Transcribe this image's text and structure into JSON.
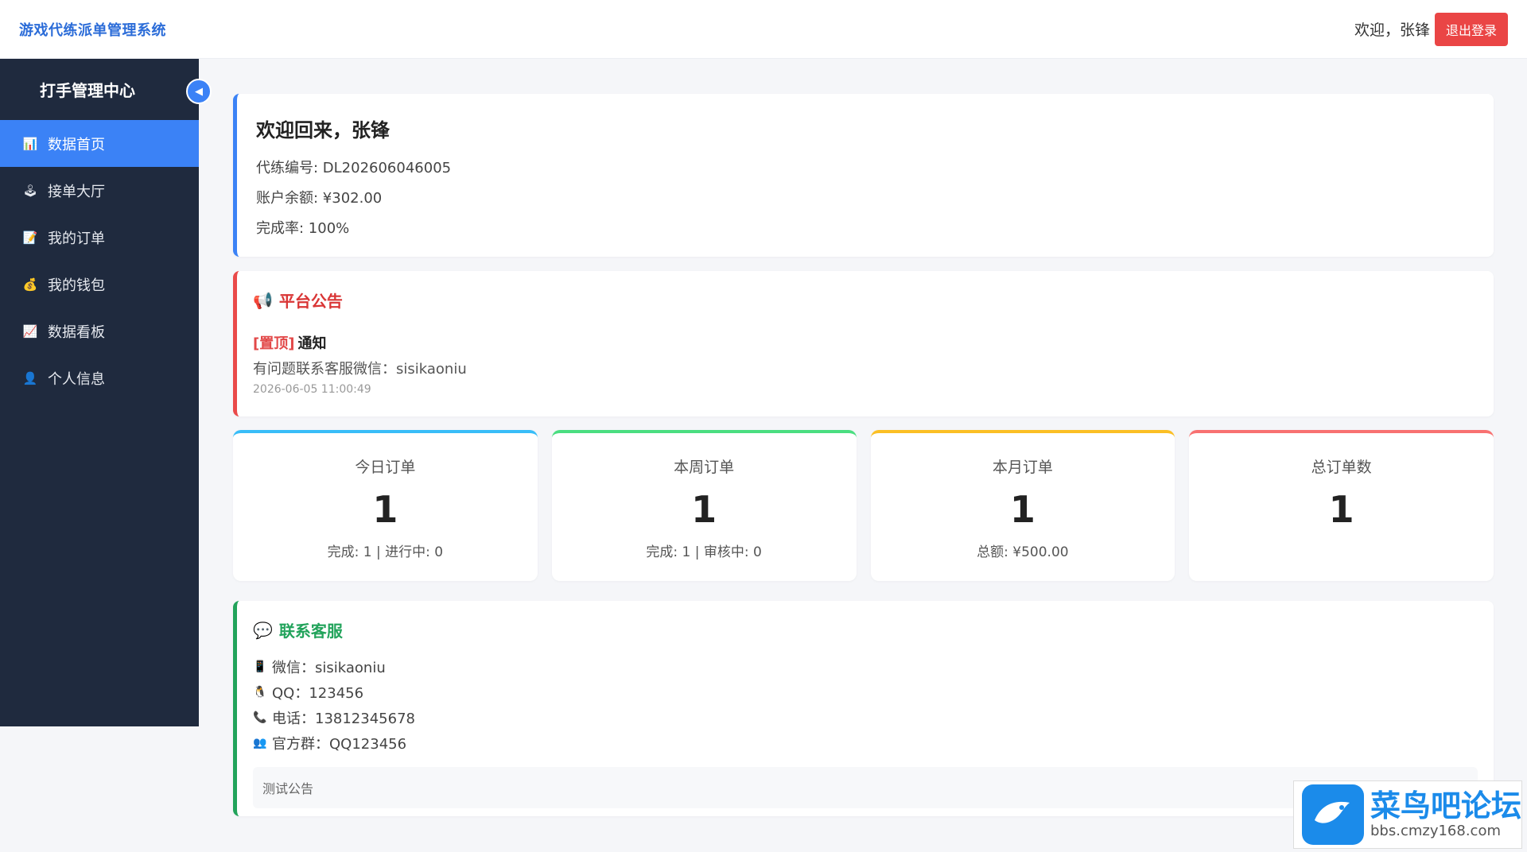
{
  "header": {
    "app_title": "游戏代练派单管理系统",
    "welcome": "欢迎，张锋",
    "logout_label": "退出登录"
  },
  "sidebar": {
    "title": "打手管理中心",
    "collapse_glyph": "◀",
    "items": [
      {
        "label": "数据首页",
        "icon": "chart-icon",
        "glyph": "📊",
        "active": true
      },
      {
        "label": "接单大厅",
        "icon": "joystick-icon",
        "glyph": "🕹",
        "active": false
      },
      {
        "label": "我的订单",
        "icon": "note-icon",
        "glyph": "📝",
        "active": false
      },
      {
        "label": "我的钱包",
        "icon": "money-bag-icon",
        "glyph": "💰",
        "active": false
      },
      {
        "label": "数据看板",
        "icon": "trend-icon",
        "glyph": "📈",
        "active": false
      },
      {
        "label": "个人信息",
        "icon": "user-icon",
        "glyph": "👤",
        "active": false
      }
    ]
  },
  "welcome_card": {
    "title": "欢迎回来，张锋",
    "code_line": "代练编号: DL202606046005",
    "balance_line": "账户余额: ¥302.00",
    "rate_line": "完成率: 100%"
  },
  "notice": {
    "icon_glyph": "📢",
    "title": "平台公告",
    "pin_tag": "[置顶]",
    "heading": "通知",
    "text": "有问题联系客服微信：sisikaoniu",
    "time": "2026-06-05 11:00:49"
  },
  "stats": [
    {
      "label": "今日订单",
      "value": "1",
      "sub": "完成: 1 | 进行中: 0",
      "color": "#38bdf8"
    },
    {
      "label": "本周订单",
      "value": "1",
      "sub": "完成: 1 | 审核中: 0",
      "color": "#4ade80"
    },
    {
      "label": "本月订单",
      "value": "1",
      "sub": "总额: ¥500.00",
      "color": "#fbbf24"
    },
    {
      "label": "总订单数",
      "value": "1",
      "sub": "",
      "color": "#f87171"
    }
  ],
  "contact": {
    "icon_glyph": "💬",
    "title": "联系客服",
    "lines": [
      {
        "icon": "phone-icon",
        "glyph": "📱",
        "text": "微信：sisikaoniu"
      },
      {
        "icon": "penguin-icon",
        "glyph": "🐧",
        "text": "QQ：123456"
      },
      {
        "icon": "telephone-icon",
        "glyph": "📞",
        "text": "电话：13812345678"
      },
      {
        "icon": "group-icon",
        "glyph": "👥",
        "text": "官方群：QQ123456"
      }
    ],
    "note": "测试公告"
  },
  "watermark": {
    "main": "菜鸟吧论坛",
    "sub": "bbs.cmzy168.com"
  },
  "colors": {
    "primary": "#3b82f6",
    "danger": "#ea4545",
    "success": "#22a35b",
    "sidebar_bg": "#1f2a3e"
  }
}
